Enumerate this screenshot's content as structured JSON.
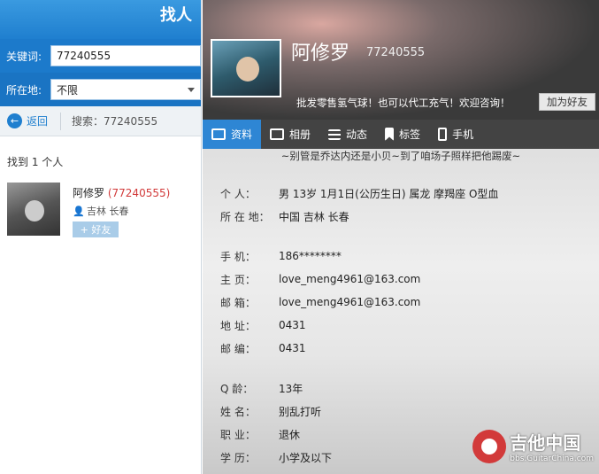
{
  "left": {
    "title": "找人",
    "keyword_label": "关键词:",
    "keyword_value": "77240555",
    "location_label": "所在地:",
    "location_value": "不限",
    "back_label": "返回",
    "search_label": "搜索：77240555",
    "found_text": "找到 1 个人",
    "result": {
      "name": "阿修罗",
      "qq": "(77240555)",
      "location": "吉林 长春",
      "add_label": "+ 好友"
    }
  },
  "profile": {
    "nickname": "阿修罗",
    "qq": "77240555",
    "signature": "批发零售氢气球！也可以代工充气！欢迎咨询！",
    "add_friend": "加为好友",
    "tabs": [
      "资料",
      "相册",
      "动态",
      "标签",
      "手机"
    ],
    "motto": "~别管是乔达内还是小贝~到了咱场子照样把他踢废~",
    "details": [
      {
        "k": "个    人：",
        "v": "男    13岁    1月1日(公历生日)    属龙    摩羯座    O型血"
      },
      {
        "k": "所 在 地：",
        "v": "中国 吉林 长春"
      },
      {
        "k": "手    机：",
        "v": "186********"
      },
      {
        "k": "主    页：",
        "v": "love_meng4961@163.com"
      },
      {
        "k": "邮    箱：",
        "v": "love_meng4961@163.com"
      },
      {
        "k": "地    址：",
        "v": "0431"
      },
      {
        "k": "邮    编：",
        "v": "0431"
      },
      {
        "k": "Q     龄：",
        "v": "13年"
      },
      {
        "k": "姓    名：",
        "v": "别乱打听"
      },
      {
        "k": "职    业：",
        "v": "退休"
      },
      {
        "k": "学    历：",
        "v": "小学及以下"
      }
    ]
  },
  "watermark": {
    "text": "吉他中国",
    "sub": "bbs.GuitarChina.com"
  }
}
